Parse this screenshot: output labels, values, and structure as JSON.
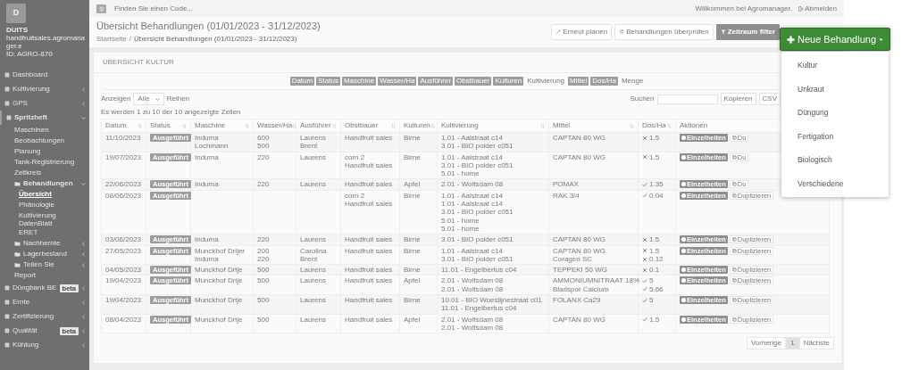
{
  "sidebar": {
    "logo": "D",
    "org": "DUITS",
    "domain": "handfruitsales.agromanager.e",
    "account_id": "ID: AGRO-870",
    "items": [
      {
        "label": "Dashboard",
        "selected": false
      },
      {
        "label": "Kultivierung",
        "selected": false,
        "expanded": false
      },
      {
        "label": "GPS",
        "selected": false,
        "expanded": false
      },
      {
        "label": "Spritzheft",
        "selected": false,
        "expanded": true,
        "children": [
          {
            "label": "Maschinen",
            "selected": false
          },
          {
            "label": "Beobachtungen",
            "selected": false
          },
          {
            "label": "Planung",
            "selected": false
          },
          {
            "label": "Tank-Registrierung",
            "selected": false
          },
          {
            "label": "Zeitkreis",
            "selected": false
          },
          {
            "label": "Behandlungen",
            "selected": false,
            "folder": true,
            "expanded": true,
            "children": [
              {
                "label": "Übersicht",
                "selected": true
              },
              {
                "label": "Phänologie",
                "selected": false
              },
              {
                "label": "Kultivierung DatenBlatt",
                "selected": false
              },
              {
                "label": "ERET",
                "selected": false
              }
            ]
          },
          {
            "label": "Nachhernte",
            "selected": false,
            "folder": true,
            "expanded": false
          },
          {
            "label": "Lagerbestand",
            "selected": false,
            "folder": true,
            "expanded": false
          },
          {
            "label": "Teilen Sie",
            "selected": false,
            "folder": true,
            "expanded": false
          },
          {
            "label": "Report",
            "selected": false
          }
        ]
      },
      {
        "label": "Düngbank BE",
        "selected": false,
        "badge": "beta",
        "expanded": false
      },
      {
        "label": "Ernte",
        "selected": false,
        "expanded": false
      },
      {
        "label": "Zertifizierung",
        "selected": false,
        "expanded": false
      },
      {
        "label": "Qualität",
        "selected": false,
        "badge": "beta",
        "expanded": false
      },
      {
        "label": "Kühlung",
        "selected": false,
        "expanded": false
      }
    ]
  },
  "topbar": {
    "search_placeholder": "Finden Sie einen Code...",
    "welcome": "Willkommen bei Agromanager.",
    "logout": "Abmelden"
  },
  "page": {
    "title": "Übersicht Behandlungen (01/01/2023 - 31/12/2023)",
    "breadcrumb_separator": "/",
    "breadcrumb": [
      "Startseite",
      "Übersicht Behandlungen (01/01/2023 - 31/12/2023)"
    ]
  },
  "actions": [
    {
      "label": "Erneut planen",
      "kind": "plain"
    },
    {
      "label": "Behandlungen überprüfen",
      "kind": "plain"
    },
    {
      "label": "Zeitraum filter",
      "kind": "dark"
    }
  ],
  "new_menu": {
    "label": "Neue Behandlung",
    "expanded": true,
    "items": [
      "Kultur",
      "Unkraut",
      "Düngung",
      "Fertigation",
      "Biologisch",
      "Verschiedene"
    ]
  },
  "card": {
    "title": "ÜBERSICHT KULTUR",
    "column_toggles": [
      {
        "label": "Datum",
        "active": true
      },
      {
        "label": "Status",
        "active": true
      },
      {
        "label": "Maschine",
        "active": true
      },
      {
        "label": "Wasser/Ha",
        "active": true
      },
      {
        "label": "Ausführer",
        "active": true
      },
      {
        "label": "Obstbauer",
        "active": true
      },
      {
        "label": "Kulturen",
        "active": true
      },
      {
        "label": "Kultivierung",
        "active": false
      },
      {
        "label": "Mittel",
        "active": true
      },
      {
        "label": "Dos/Ha",
        "active": true
      },
      {
        "label": "Menge",
        "active": false
      }
    ],
    "length": {
      "before": "Anzeigen",
      "value": "Alle",
      "after": "Reihen"
    },
    "search_label": "Suchen",
    "export_buttons": [
      "Kopieren",
      "CSV"
    ],
    "info": "Es werden 1 zu 10 der 10 angezeigte Zeilen",
    "table": {
      "columns": [
        "Datum",
        "Status",
        "Maschine",
        "Wasser/Ha",
        "Ausführer",
        "Obstbauer",
        "Kulturen",
        "Kultivierung",
        "Mittel",
        "Dos/Ha",
        "Aktionen"
      ],
      "rows": [
        {
          "datum": "11/10/2023",
          "status": "Ausgeführt",
          "maschine": [
            "Induma",
            "Lochmann"
          ],
          "wasser": [
            "600",
            "500"
          ],
          "ausfuehrer": [
            "Laurens",
            "Brent"
          ],
          "obstbauer": [
            "Handfruit sales"
          ],
          "kulturen": "Birne",
          "kultivierung": [
            "1.01 - Aalstraat c14",
            "3.01 - BIO polder c051"
          ],
          "mittel": [
            "CAPTAN 80 WG"
          ],
          "dosis": [
            {
              "value": "1.5",
              "ok": false
            }
          ],
          "details": "Einzelheiten",
          "duplicate": "Du"
        },
        {
          "datum": "19/07/2023",
          "status": "Ausgeführt",
          "maschine": [
            "Induma"
          ],
          "wasser": [
            "220"
          ],
          "ausfuehrer": [
            "Laurens"
          ],
          "obstbauer": [
            "corn 2",
            "Handfruit sales"
          ],
          "kulturen": "Birne",
          "kultivierung": [
            "1.01 - Aalstraat c14",
            "3.01 - BIO polder c051",
            "5.01 - home"
          ],
          "mittel": [
            "CAPTAN 80 WG"
          ],
          "dosis": [
            {
              "value": "1.5",
              "ok": false
            }
          ],
          "details": "Einzelheiten",
          "duplicate": "Du"
        },
        {
          "datum": "22/06/2023",
          "status": "Ausgeführt",
          "maschine": [
            "Induma"
          ],
          "wasser": [
            "220"
          ],
          "ausfuehrer": [
            "Laurens"
          ],
          "obstbauer": [
            "Handfruit sales"
          ],
          "kulturen": "Apfel",
          "kultivierung": [
            "2.01 - Wolfsdam 08"
          ],
          "mittel": [
            "POMAX"
          ],
          "dosis": [
            {
              "value": "1.35",
              "ok": true
            }
          ],
          "details": "Einzelheiten",
          "duplicate": "Du"
        },
        {
          "datum": "08/06/2023",
          "status": "Ausgeführt",
          "obstbauer": [
            "corn 2",
            "Handfruit sales"
          ],
          "kulturen": "Birne",
          "kultivierung": [
            "1.01 - Aalstraat c14",
            "1.01 - Aalstraat c14",
            "3.01 - BIO polder c051",
            "5.01 - home",
            "5.01 - home"
          ],
          "mittel": [
            "RAK 3/4"
          ],
          "dosis": [
            {
              "value": "0.04",
              "ok": true
            }
          ],
          "details": "Einzelheiten",
          "duplicate": "Duplizieren"
        },
        {
          "datum": "03/06/2023",
          "status": "Ausgeführt",
          "maschine": [
            "Induma"
          ],
          "wasser": [
            "220"
          ],
          "ausfuehrer": [
            "Laurens"
          ],
          "obstbauer": [
            "Handfruit sales"
          ],
          "kulturen": "Birne",
          "kultivierung": [
            "3.01 - BIO polder c051"
          ],
          "mittel": [
            "CAPTAN 80 WG"
          ],
          "dosis": [
            {
              "value": "1.5",
              "ok": false
            }
          ],
          "details": "Einzelheiten",
          "duplicate": "Duplizieren"
        },
        {
          "datum": "27/05/2023",
          "status": "Ausgeführt",
          "maschine": [
            "Munckhof Drijer",
            "Induma"
          ],
          "wasser": [
            "200",
            "220"
          ],
          "ausfuehrer": [
            "Carolina",
            "Brent"
          ],
          "obstbauer": [
            "Handfruit sales"
          ],
          "kulturen": "Birne",
          "kultivierung": [
            "1.01 - Aalstraat c14",
            "3.01 - BIO polder c051"
          ],
          "mittel": [
            "CAPTAN 80 WG",
            "Coragen SC"
          ],
          "dosis": [
            {
              "value": "1.5",
              "ok": false
            },
            {
              "value": "0.12",
              "ok": false
            }
          ],
          "details": "Einzelheiten",
          "duplicate": "Duplizieren"
        },
        {
          "datum": "04/05/2023",
          "status": "Ausgeführt",
          "maschine": [
            "Munckhof Drije"
          ],
          "wasser": [
            "500"
          ],
          "ausfuehrer": [
            "Laurens"
          ],
          "obstbauer": [
            "Handfruit sales"
          ],
          "kulturen": "Birne",
          "kultivierung": [
            "11.01 - Engelbertus c04"
          ],
          "mittel": [
            "TEPPEKI 50 WG"
          ],
          "dosis": [
            {
              "value": "0.1",
              "ok": false
            }
          ],
          "details": "Einzelheiten",
          "duplicate": "Duplizieren"
        },
        {
          "datum": "19/04/2023",
          "status": "Ausgeführt",
          "maschine": [
            "Munckhof Drije"
          ],
          "wasser": [
            "500"
          ],
          "ausfuehrer": [
            "Laurens"
          ],
          "obstbauer": [
            "Handfruit sales"
          ],
          "kulturen": "Apfel",
          "kultivierung": [
            "2.01 - Wolfsdam 08",
            "2.01 - Wolfsdam 08"
          ],
          "mittel": [
            "AMMONIUMNITRAAT 18%",
            "Bladspor Calcium"
          ],
          "dosis": [
            {
              "value": "5",
              "ok": true
            },
            {
              "value": "5.66",
              "ok": true
            }
          ],
          "details": "Einzelheiten",
          "duplicate": "Duplizieren"
        },
        {
          "datum": "19/04/2023",
          "status": "Ausgeführt",
          "maschine": [
            "Munckhof Drije"
          ],
          "wasser": [
            "500"
          ],
          "ausfuehrer": [
            "Laurens"
          ],
          "obstbauer": [
            "Handfruit sales"
          ],
          "kulturen": "Birne",
          "kultivierung": [
            "10.01 - BIO Woeslijnestraat c01",
            "11.01 - Engelbertus c04"
          ],
          "mittel": [
            "FOLANX Ca29"
          ],
          "dosis": [
            {
              "value": "5",
              "ok": true
            }
          ],
          "details": "Einzelheiten",
          "duplicate": "Duplizieren"
        },
        {
          "datum": "08/04/2023",
          "status": "Ausgeführt",
          "maschine": [
            "Munckhof Drije"
          ],
          "wasser": [
            "500"
          ],
          "ausfuehrer": [
            "Laurens"
          ],
          "obstbauer": [
            "Handfruit sales"
          ],
          "kulturen": "Apfel",
          "kultivierung": [
            "2.01 - Wolfsdam 08",
            "2.01 - Wolfsdam 08"
          ],
          "mittel": [
            "CAPTAN 80 WG"
          ],
          "dosis": [
            {
              "value": "1.5",
              "ok": true
            }
          ],
          "details": "Einzelheiten",
          "duplicate": "Duplizieren"
        }
      ]
    },
    "pagination": {
      "previous": "Vorherige",
      "pages": [
        {
          "label": "1",
          "selected": true
        }
      ],
      "next": "Nächste"
    }
  }
}
